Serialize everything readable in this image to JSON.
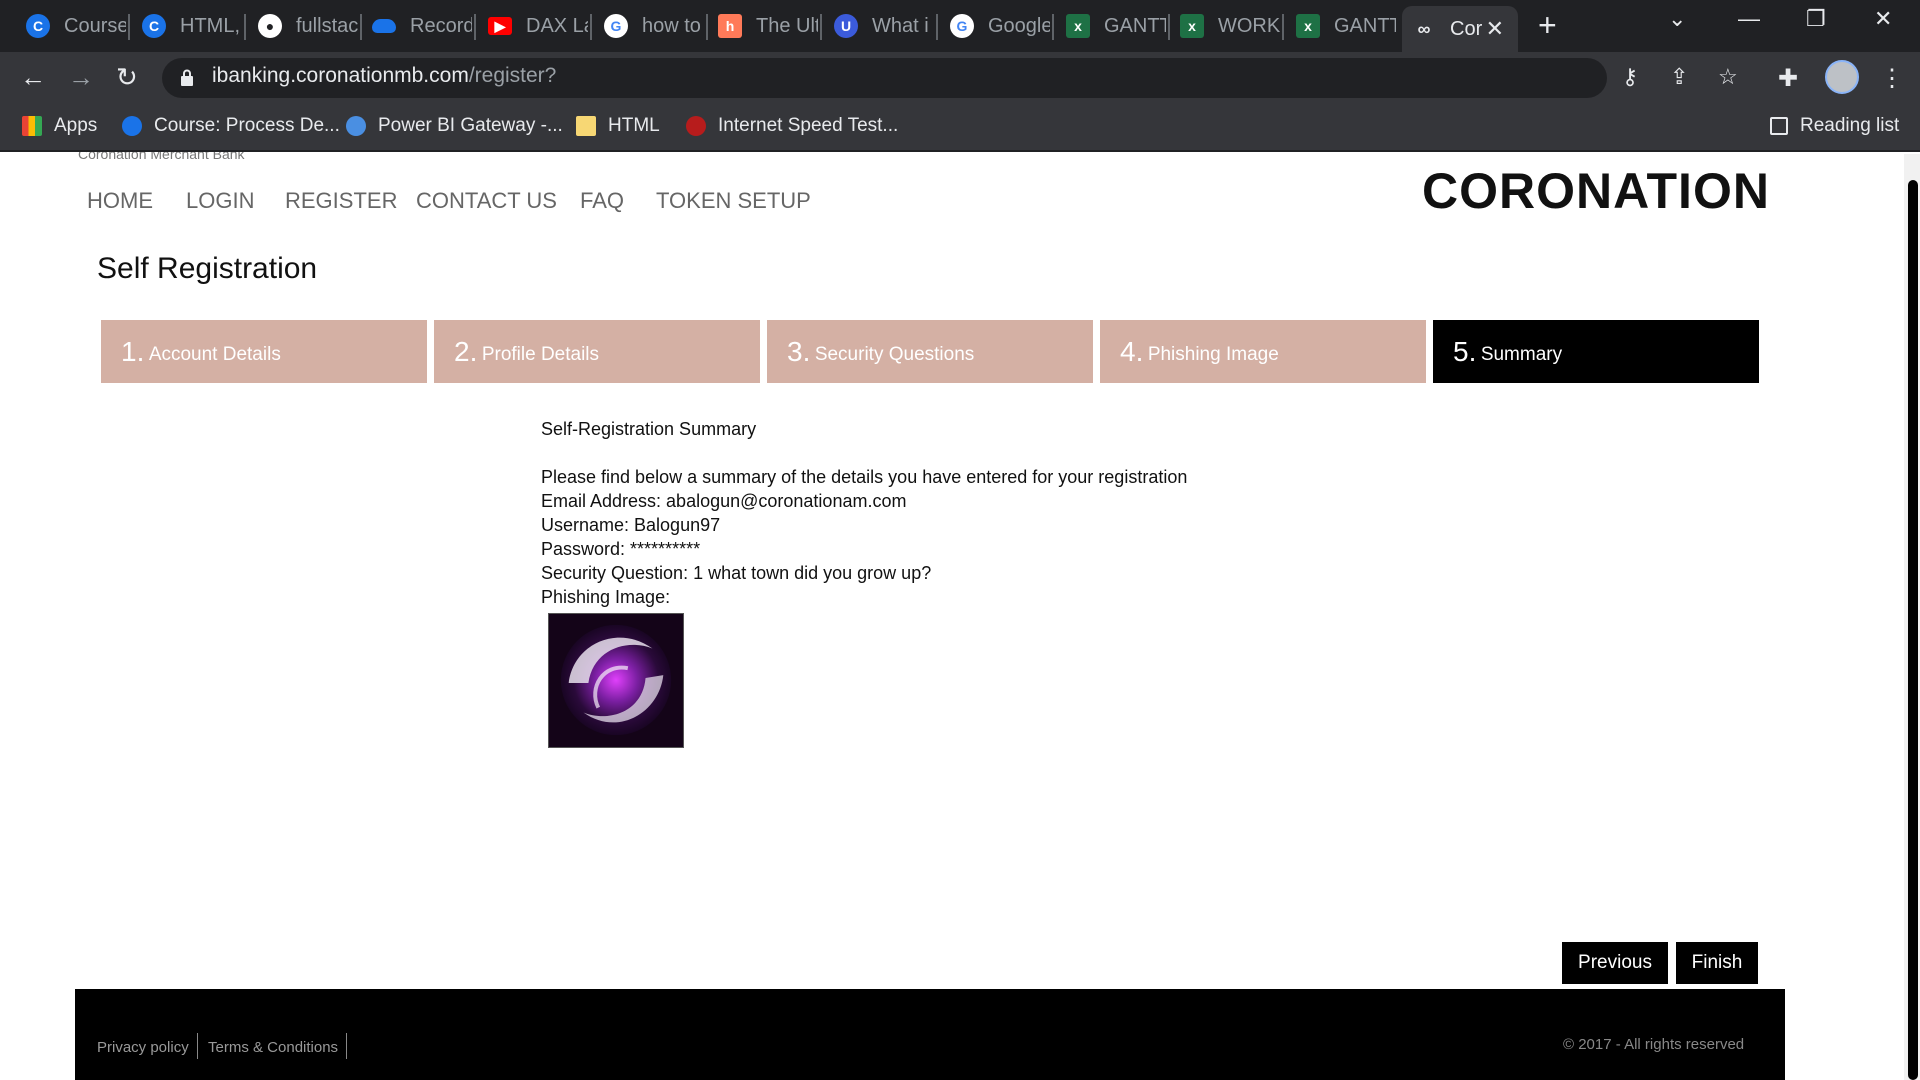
{
  "browser": {
    "tabs": [
      {
        "title": "Course",
        "icon": "coursera-icon",
        "color": "#1a73e8"
      },
      {
        "title": "HTML,",
        "icon": "coursera-icon",
        "color": "#1a73e8"
      },
      {
        "title": "fullstac",
        "icon": "github-icon",
        "color": "#ffffff"
      },
      {
        "title": "Record",
        "icon": "onedrive-icon",
        "color": "#1a73e8"
      },
      {
        "title": "DAX La",
        "icon": "youtube-icon",
        "color": "#ff0000"
      },
      {
        "title": "how to",
        "icon": "google-icon",
        "color": "#ffffff"
      },
      {
        "title": "The Ult",
        "icon": "hubspot-icon",
        "color": "#ff7a59"
      },
      {
        "title": "What i",
        "icon": "u-icon",
        "color": "#3b5bdb"
      },
      {
        "title": "Google",
        "icon": "google-icon",
        "color": "#ffffff"
      },
      {
        "title": "GANTT",
        "icon": "excel-icon",
        "color": "#1e7145"
      },
      {
        "title": "WORKI",
        "icon": "excel-icon",
        "color": "#1e7145"
      },
      {
        "title": "GANTT",
        "icon": "excel-icon",
        "color": "#1e7145"
      },
      {
        "title": "Cor",
        "icon": "coronation-icon",
        "color": "#e8eaed",
        "active": true
      }
    ],
    "url_host": "ibanking.coronationmb.com",
    "url_path": "/register?",
    "bookmarks": [
      "Apps",
      "Course: Process De...",
      "Power BI Gateway -...",
      "HTML",
      "Internet Speed Test..."
    ],
    "reading_list": "Reading list"
  },
  "site": {
    "brand_small": "Coronation Merchant Bank",
    "logo": "CORONATION",
    "nav": [
      "HOME",
      "LOGIN",
      "REGISTER",
      "CONTACT US",
      "FAQ",
      "TOKEN SETUP"
    ],
    "page_title": "Self Registration",
    "steps": [
      {
        "num": "1.",
        "label": "Account Details"
      },
      {
        "num": "2.",
        "label": "Profile Details"
      },
      {
        "num": "3.",
        "label": "Security Questions"
      },
      {
        "num": "4.",
        "label": "Phishing Image"
      },
      {
        "num": "5.",
        "label": "Summary",
        "active": true
      }
    ],
    "summary": {
      "heading": "Self-Registration Summary",
      "intro": "Please find below a summary of the details you have entered for your registration",
      "email": "Email Address: abalogun@coronationam.com",
      "username": "Username: Balogun97",
      "password": "Password: **********",
      "security_question": "Security Question: 1 what town did you grow up?",
      "phishing_label": "Phishing Image:"
    },
    "buttons": {
      "previous": "Previous",
      "finish": "Finish"
    },
    "footer": {
      "privacy": "Privacy policy",
      "terms": "Terms & Conditions",
      "copyright": "© 2017 - All rights reserved"
    },
    "colors": {
      "step_bg": "#d4b0a4",
      "step_active": "#000000",
      "button_bg": "#000000"
    }
  }
}
